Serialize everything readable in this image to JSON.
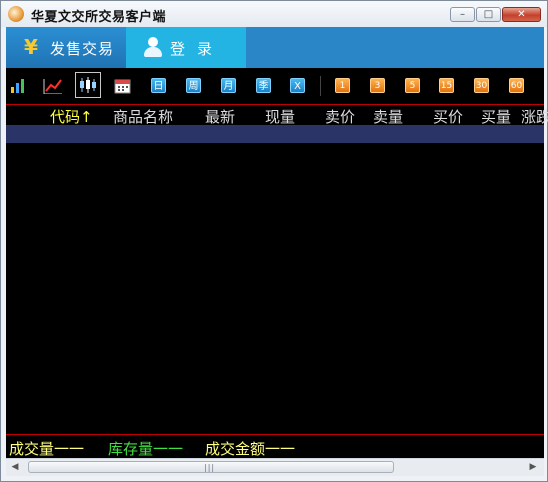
{
  "window": {
    "title": "华夏文交所交易客户端",
    "controls": {
      "minimize": "–",
      "maximize": "□",
      "close": "✕"
    }
  },
  "tabs": [
    {
      "label": "发售交易",
      "icon": "yen-icon"
    },
    {
      "label": "登录",
      "icon": "user-icon"
    }
  ],
  "toolbar": {
    "chart_tools": [
      "bar-chart-icon",
      "line-chart-icon",
      "candlestick-icon",
      "calendar-icon"
    ],
    "period_buttons": [
      "日",
      "周",
      "月",
      "季",
      "X"
    ],
    "minute_buttons": [
      "1",
      "3",
      "5",
      "15",
      "30",
      "60"
    ]
  },
  "grid": {
    "columns": [
      "代码↑",
      "商品名称",
      "最新",
      "现量",
      "卖价",
      "卖量",
      "买价",
      "买量",
      "涨跌"
    ],
    "active_column": "代码↑"
  },
  "status": {
    "volume": "成交量一一",
    "stock": "库存量一一",
    "amount": "成交金额一一"
  },
  "colors": {
    "tab_active": "#1f73b3",
    "tab_login": "#23b4e3",
    "grid_bg": "#000000",
    "divider": "#c00000",
    "selected_row": "#2a3466",
    "active_column": "#ffff40",
    "stock_text": "#40e040",
    "status_text": "#ffff80"
  },
  "scrollbar": {
    "grip": "|||"
  }
}
